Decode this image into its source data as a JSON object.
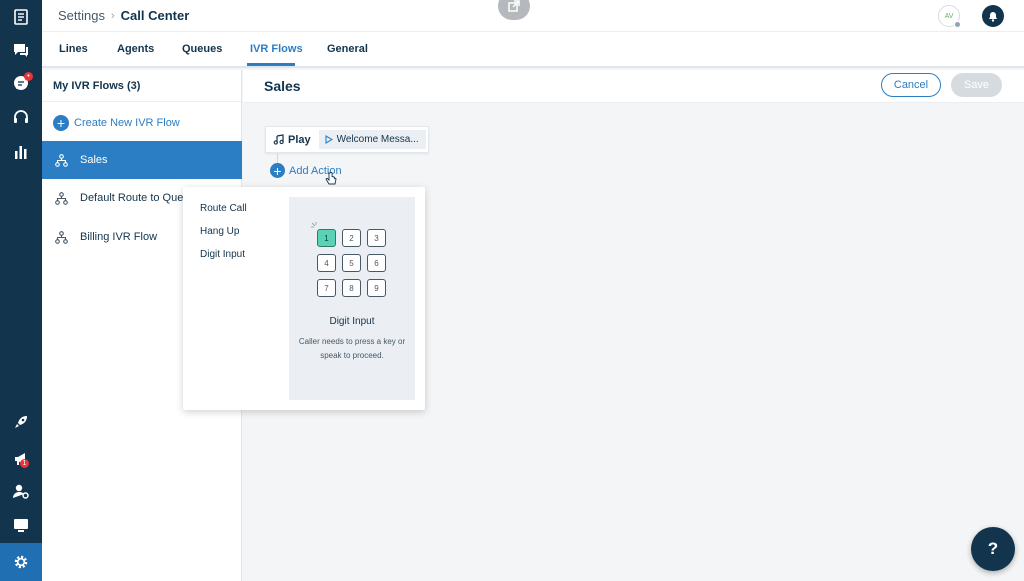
{
  "rail": {
    "items": [
      {
        "icon": "book-icon"
      },
      {
        "icon": "chat-icon"
      },
      {
        "icon": "messages-icon",
        "badge": "•"
      },
      {
        "icon": "headset-icon"
      },
      {
        "icon": "bar-chart-icon"
      },
      {
        "icon": "rocket-icon"
      },
      {
        "icon": "megaphone-icon",
        "badge": "1"
      },
      {
        "icon": "user-settings-icon"
      },
      {
        "icon": "monitor-icon"
      },
      {
        "icon": "gear-icon"
      }
    ]
  },
  "breadcrumb": {
    "root": "Settings",
    "separator": "›",
    "current": "Call Center"
  },
  "header": {
    "avatar_initials": "AV"
  },
  "tabs": [
    {
      "label": "Lines"
    },
    {
      "label": "Agents"
    },
    {
      "label": "Queues"
    },
    {
      "label": "IVR Flows",
      "active": true
    },
    {
      "label": "General"
    }
  ],
  "sidebar": {
    "title": "My IVR Flows (3)",
    "create_label": "Create New IVR Flow",
    "flows": [
      {
        "label": "Sales",
        "active": true
      },
      {
        "label": "Default Route to Queue"
      },
      {
        "label": "Billing IVR Flow"
      }
    ]
  },
  "main": {
    "title": "Sales",
    "cancel_label": "Cancel",
    "save_label": "Save",
    "play_label": "Play",
    "message_label": "Welcome Messa...",
    "add_action_label": "Add Action"
  },
  "dropdown": {
    "items": [
      "Route Call",
      "Hang Up",
      "Digit Input"
    ],
    "preview_title": "Digit Input",
    "preview_desc": "Caller needs to press a key or speak to proceed.",
    "keys": [
      "1",
      "2",
      "3",
      "4",
      "5",
      "6",
      "7",
      "8",
      "9"
    ],
    "highlighted_key": "1"
  },
  "help_label": "?",
  "colors": {
    "rail": "#12344d",
    "accent": "#2c7ec4",
    "key_highlight": "#5ad2b6"
  }
}
